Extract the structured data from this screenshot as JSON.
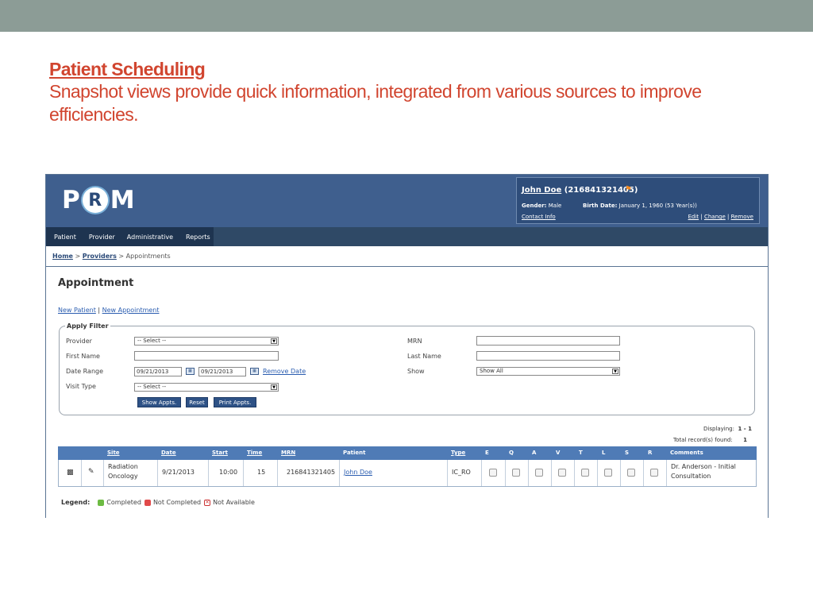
{
  "slide": {
    "title": "Patient Scheduling",
    "subtitle": "Snapshot views provide quick information, integrated from various sources to improve efficiencies."
  },
  "app": {
    "logo": {
      "left": "P",
      "middle": "R",
      "right": "M"
    },
    "patient": {
      "name": "John Doe",
      "id": "(216841321405)",
      "gender_label": "Gender:",
      "gender_value": "Male",
      "birth_label": "Birth Date:",
      "birth_value": "January 1, 1960 (53 Year(s))",
      "contact_info": "Contact Info",
      "edit": "Edit",
      "change": "Change",
      "remove": "Remove"
    },
    "nav": [
      "Patient",
      "Provider",
      "Administrative",
      "Reports"
    ],
    "breadcrumb": {
      "home": "Home",
      "providers": "Providers",
      "current": "Appointments",
      "sep": ">"
    },
    "page_title": "Appointment",
    "links": {
      "new_patient": "New Patient",
      "new_appointment": "New Appointment"
    },
    "filter": {
      "legend": "Apply Filter",
      "provider_label": "Provider",
      "provider_value": "-- Select --",
      "first_name_label": "First Name",
      "first_name_value": "",
      "date_range_label": "Date Range",
      "date_from": "09/21/2013",
      "date_to": "09/21/2013",
      "remove_date": "Remove Date",
      "visit_type_label": "Visit Type",
      "visit_type_value": "-- Select --",
      "mrn_label": "MRN",
      "mrn_value": "",
      "last_name_label": "Last Name",
      "last_name_value": "",
      "show_label": "Show",
      "show_value": "Show All",
      "buttons": {
        "show": "Show Appts.",
        "reset": "Reset",
        "print": "Print Appts."
      }
    },
    "results": {
      "displaying_label": "Displaying:",
      "displaying_value": "1 - 1",
      "total_label": "Total record(s) found:",
      "total_value": "1"
    },
    "table": {
      "headers": {
        "site": "Site",
        "date": "Date",
        "start": "Start",
        "time": "Time",
        "mrn": "MRN",
        "patient": "Patient",
        "type": "Type",
        "e": "E",
        "q": "Q",
        "a": "A",
        "v": "V",
        "t": "T",
        "l": "L",
        "s": "S",
        "r": "R",
        "comments": "Comments"
      },
      "row": {
        "site_1": "Radiation",
        "site_2": "Oncology",
        "date": "9/21/2013",
        "start": "10:00",
        "time": "15",
        "mrn": "216841321405",
        "patient": "John Doe",
        "type": "IC_RO",
        "comments_1": "Dr. Anderson - Initial",
        "comments_2": "Consultation"
      }
    },
    "legend": {
      "label": "Legend:",
      "completed": "Completed",
      "not_completed": "Not Completed",
      "not_available": "Not Available"
    }
  }
}
